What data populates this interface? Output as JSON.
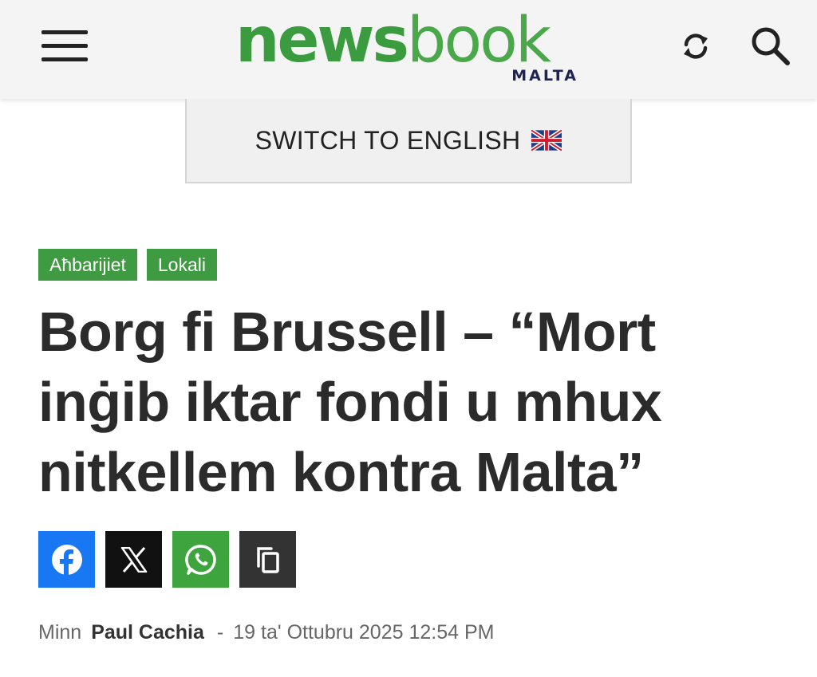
{
  "header": {
    "logo_primary": "news",
    "logo_secondary": "book",
    "logo_sub": "MALTA",
    "menu_icon": "hamburger-menu-icon",
    "refresh_icon": "refresh-icon",
    "search_icon": "search-icon"
  },
  "switch_language": {
    "label": "SWITCH TO ENGLISH",
    "flag_icon": "uk-flag-icon"
  },
  "article": {
    "categories": [
      "Aħbarijiet",
      "Lokali"
    ],
    "title": "Borg fi Brussell – “Mort inġib iktar fondi u mhux nitkellem kontra Malta”",
    "share_buttons": [
      {
        "icon": "facebook-icon",
        "color": "#1877f2"
      },
      {
        "icon": "x-icon",
        "color": "#111111"
      },
      {
        "icon": "whatsapp-icon",
        "color": "#3ea53e"
      },
      {
        "icon": "copy-icon",
        "color": "#333333"
      }
    ],
    "byline": {
      "prefix": "Minn",
      "author": "Paul Cachia",
      "separator": "-",
      "date": "19 ta' Ottubru 2025 12:54 PM"
    }
  },
  "colors": {
    "brand_green": "#3f9b41",
    "brand_navy": "#1e2450",
    "header_bg": "#f4f4f4"
  }
}
